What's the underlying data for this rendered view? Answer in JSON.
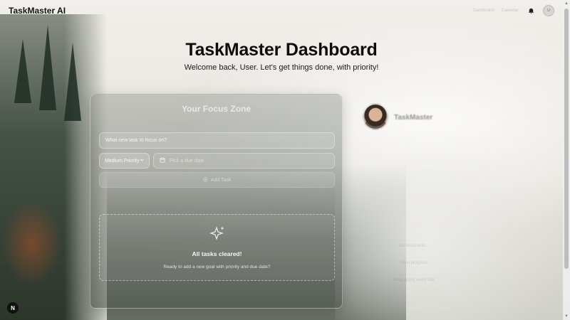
{
  "app": {
    "brand": "TaskMaster AI"
  },
  "topbar": {
    "faint_link_1": "Dashboard",
    "faint_link_2": "Calendar",
    "avatar_initials": "U"
  },
  "header": {
    "title": "TaskMaster Dashboard",
    "subtitle": "Welcome back, User. Let's get things done, with priority!"
  },
  "focus_panel": {
    "title": "Your Focus Zone",
    "task_input_placeholder": "What new task to focus on?",
    "priority_selected": "Medium Priority",
    "date_placeholder": "Pick a due date",
    "add_button_label": "Add Task",
    "empty_title": "All tasks cleared!",
    "empty_subtitle": "Ready to add a new goal with priority and due date?"
  },
  "profile": {
    "name": "TaskMaster",
    "faint_line_1": "Achievements",
    "faint_line_2": "View progress",
    "faint_line_3": "Keep going every day"
  },
  "badge": {
    "label": "N"
  },
  "colors": {
    "title_text": "#0d0d0d",
    "badge_bg": "#111111"
  }
}
